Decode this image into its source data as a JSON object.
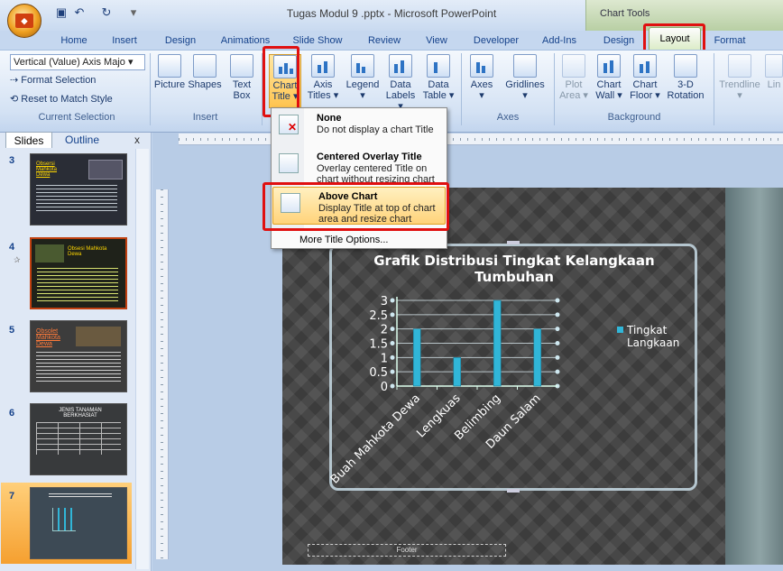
{
  "window": {
    "title": "Tugas Modul 9 .pptx - Microsoft PowerPoint",
    "context_label": "Chart Tools",
    "office_glyph": "Office"
  },
  "quick_access": [
    "save-icon",
    "undo-icon",
    "redo-icon"
  ],
  "tabs": {
    "home": "Home",
    "insert": "Insert",
    "design": "Design",
    "animations": "Animations",
    "slideshow": "Slide Show",
    "review": "Review",
    "view": "View",
    "developer": "Developer",
    "addins": "Add-Ins",
    "ctx_design": "Design",
    "layout": "Layout",
    "format": "Format"
  },
  "ribbon": {
    "current_selection": {
      "dropdown": "Vertical (Value) Axis Majo ▾",
      "format_selection": "Format Selection",
      "reset_style": "Reset to Match Style",
      "label": "Current Selection"
    },
    "insert": {
      "picture": "Picture",
      "shapes": "Shapes",
      "textbox_1": "Text",
      "textbox_2": "Box",
      "label": "Insert"
    },
    "labels_group": {
      "chart_title_1": "Chart",
      "chart_title_2": "Title ▾",
      "axis_titles_1": "Axis",
      "axis_titles_2": "Titles ▾",
      "legend_1": "Legend",
      "legend_2": "▾",
      "data_labels_1": "Data",
      "data_labels_2": "Labels ▾",
      "data_table_1": "Data",
      "data_table_2": "Table ▾"
    },
    "axes_group": {
      "axes": "Axes",
      "axes_arrow": "▾",
      "gridlines": "Gridlines",
      "gridlines_arrow": "▾",
      "label": "Axes"
    },
    "background_group": {
      "plot_area_1": "Plot",
      "plot_area_2": "Area ▾",
      "chart_wall_1": "Chart",
      "chart_wall_2": "Wall ▾",
      "chart_floor_1": "Chart",
      "chart_floor_2": "Floor ▾",
      "rotation_1": "3-D",
      "rotation_2": "Rotation",
      "label": "Background"
    },
    "analysis": {
      "trendline": "Trendline",
      "lines": "Lin",
      "trend_arrow": "▾"
    }
  },
  "chart_title_menu": {
    "items": [
      {
        "title": "None",
        "desc": "Do not display a chart Title"
      },
      {
        "title": "Centered Overlay Title",
        "desc": "Overlay centered Title on chart without resizing chart"
      },
      {
        "title": "Above Chart",
        "desc": "Display Title at top of chart area and resize chart"
      }
    ],
    "more": "More Title Options..."
  },
  "pane": {
    "tab_slides": "Slides",
    "tab_outline": "Outline",
    "close": "x",
    "thumbnails": [
      {
        "num": "3",
        "title": "Obsersi Mahkota Dewa",
        "bg": "#2a2d36"
      },
      {
        "num": "4",
        "title": "Obsesi Mahkota Dewa",
        "bg": "#1f221a"
      },
      {
        "num": "5",
        "title": "Obsolet Mahkota Dewa",
        "bg": "#3c3c3c"
      },
      {
        "num": "6",
        "title": "JENIS TANAMAN BERKHASIAT",
        "bg": "#383a3c"
      },
      {
        "num": "7",
        "title": "",
        "bg": "#3d4a55"
      }
    ]
  },
  "slide": {
    "footer": "Footer"
  },
  "chart_data": {
    "type": "bar",
    "title": "Grafik Distribusi Tingkat Kelangkaan Tumbuhan",
    "categories": [
      "Buah Mahkota Dewa",
      "Lengkuas",
      "Belimbing",
      "Daun Salam"
    ],
    "series": [
      {
        "name": "Tingkat Langkaan",
        "values": [
          2,
          1,
          3,
          2
        ],
        "color": "#31b6d8"
      }
    ],
    "yticks": [
      "0",
      "0.5",
      "1",
      "1.5",
      "2",
      "2.5",
      "3"
    ],
    "ylim": [
      0,
      3
    ],
    "grid": true,
    "legend_position": "right"
  },
  "colors": {
    "highlight": "#e01010",
    "ribbon_bg": "#dbe6f4",
    "menu_hover": "#ffd37a"
  }
}
